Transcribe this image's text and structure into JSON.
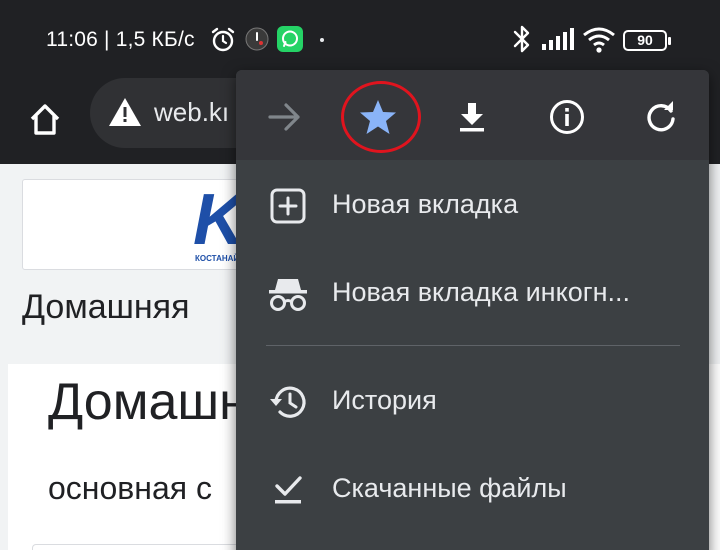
{
  "status_bar": {
    "time_and_speed": "11:06 | 1,5 КБ/с",
    "battery_level": "90",
    "icons": [
      "alarm-icon",
      "app-notification-icon",
      "whatsapp-icon",
      "bluetooth-icon",
      "signal-icon",
      "wifi-icon",
      "battery-icon"
    ]
  },
  "toolbar": {
    "url": "web.kı"
  },
  "page": {
    "logo_letter": "K",
    "logo_caption": "КОСТАНАЙ",
    "home_crumb": "Домашняя",
    "content_title": "Домашн",
    "content_subtitle": "основная с"
  },
  "menu": {
    "actions": [
      "forward-icon",
      "bookmark-star-icon",
      "download-icon",
      "info-icon",
      "reload-icon"
    ],
    "items": [
      {
        "icon": "new-tab-icon",
        "label": "Новая вкладка"
      },
      {
        "icon": "incognito-icon",
        "label": "Новая вкладка инкогн..."
      },
      {
        "icon": "history-icon",
        "label": "История"
      },
      {
        "icon": "downloads-icon",
        "label": "Скачанные файлы"
      }
    ]
  },
  "colors": {
    "toolbar_bg": "#202124",
    "menu_bg": "#3c4043",
    "star_active": "#8ab4f8",
    "highlight_red": "#e0141e",
    "whatsapp_green": "#25d366",
    "logo_blue": "#1e4fa8"
  }
}
